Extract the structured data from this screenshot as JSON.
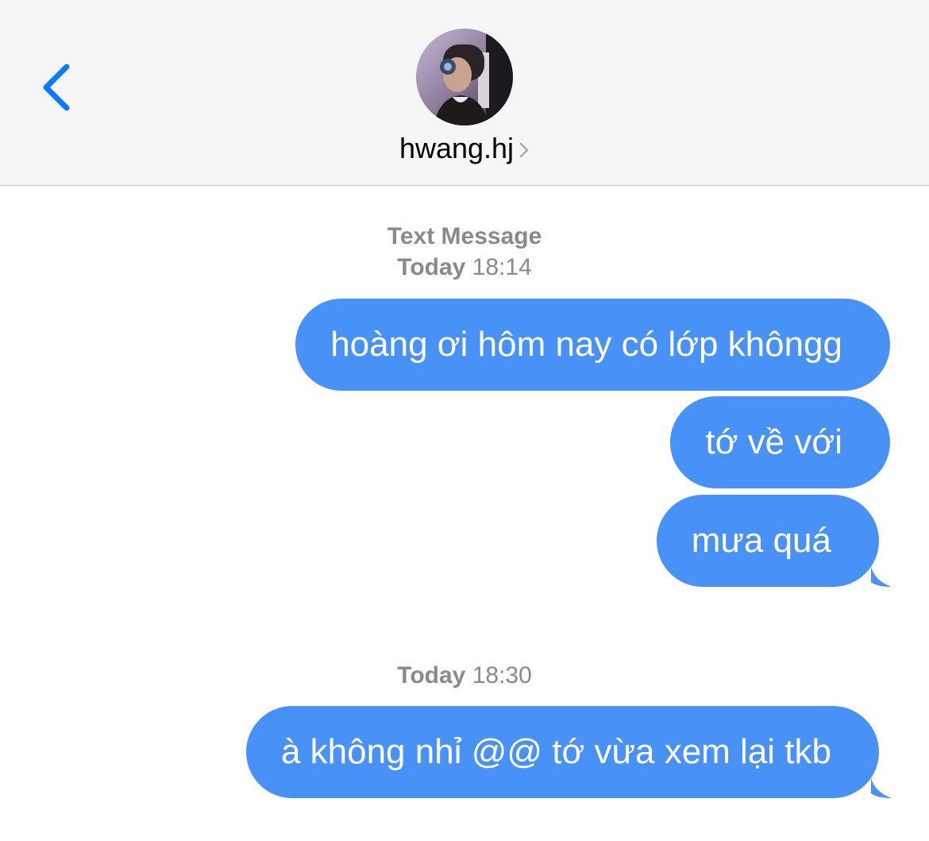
{
  "header": {
    "contact_name": "hwang.hj",
    "back_icon": "chevron-left-icon",
    "detail_icon": "chevron-right-icon",
    "accent_color": "#0a7aff"
  },
  "thread": {
    "groups": [
      {
        "service_label": "Text Message",
        "day_label": "Today",
        "time_label": "18:14",
        "messages": [
          "hoàng ơi hôm nay có lớp khôngg",
          "tớ về với",
          "mưa quá"
        ]
      },
      {
        "day_label": "Today",
        "time_label": "18:30",
        "messages": [
          "à không nhỉ @@ tớ vừa xem lại tkb"
        ]
      }
    ],
    "bubble_color": "#4891f7"
  }
}
